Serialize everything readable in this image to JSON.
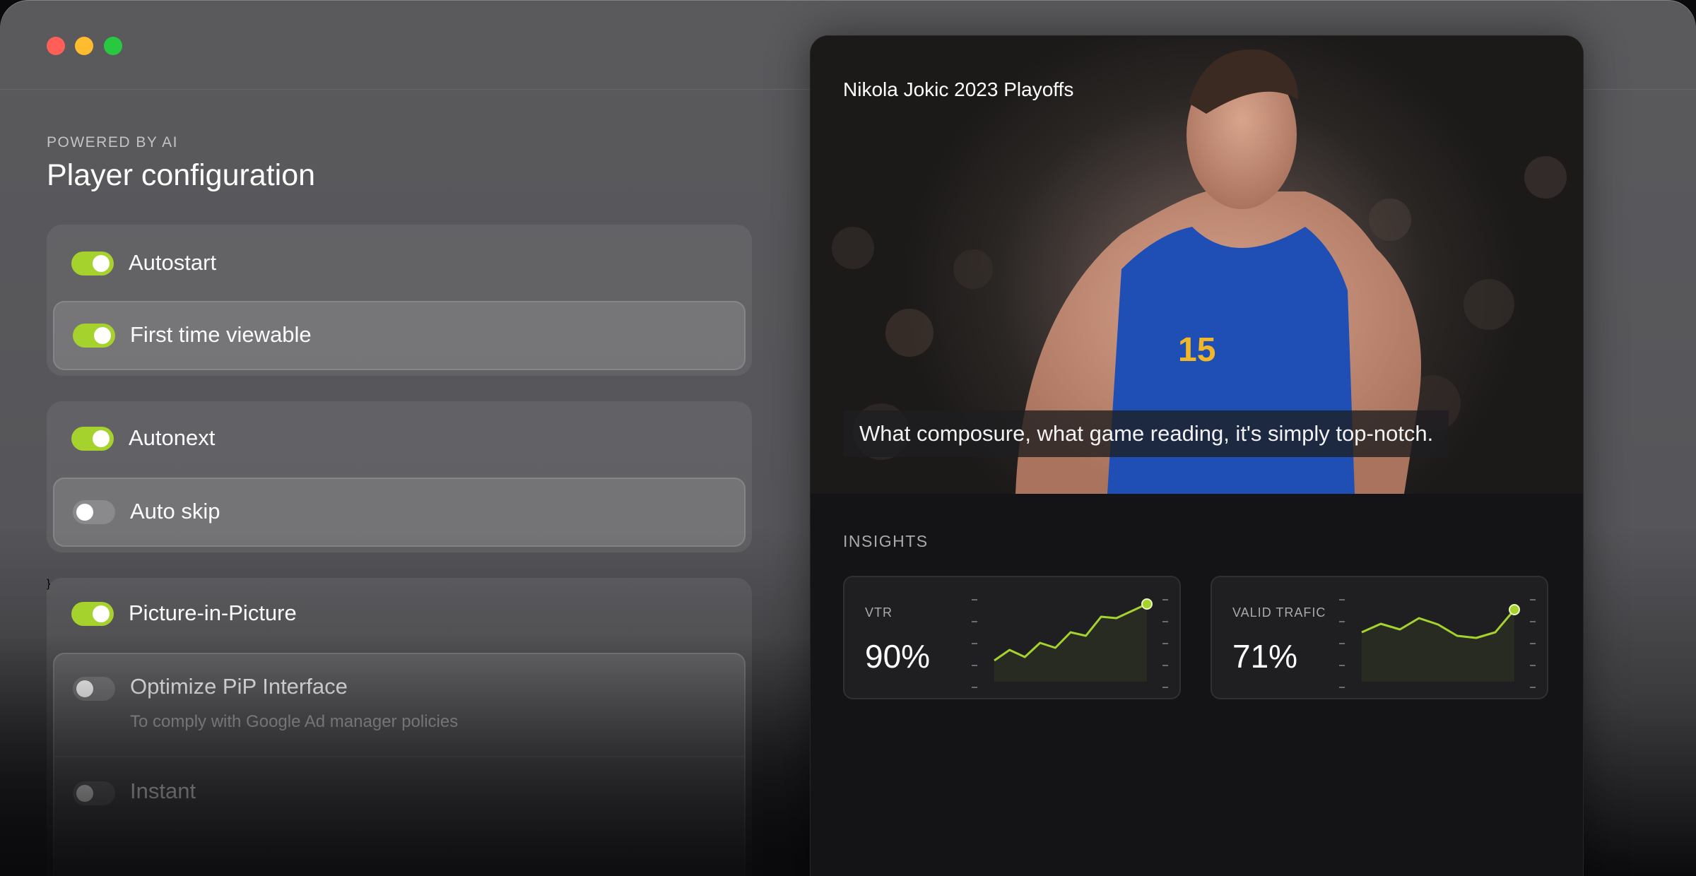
{
  "config": {
    "eyebrow": "POWERED BY AI",
    "title": "Player configuration",
    "groups": [
      {
        "main": {
          "label": "Autostart",
          "on": true
        },
        "sub": {
          "label": "First time viewable",
          "on": true
        }
      },
      {
        "main": {
          "label": "Autonext",
          "on": true
        },
        "sub": {
          "label": "Auto skip",
          "on": false
        }
      },
      {
        "main": {
          "label": "Picture-in-Picture",
          "on": true
        },
        "sub": {
          "label": "Optimize PiP Interface",
          "hint": "To comply with Google Ad manager policies",
          "on": false
        },
        "sub2": {
          "label": "Instant",
          "on": false
        }
      }
    ]
  },
  "video": {
    "title": "Nikola Jokic 2023 Playoffs",
    "caption": "What composure, what game reading, it's simply top-notch."
  },
  "insights": {
    "heading": "INSIGHTS",
    "accent": "#a6d22d",
    "cards": [
      {
        "name": "VTR",
        "value": "90%",
        "trend": [
          0.2,
          0.35,
          0.25,
          0.45,
          0.38,
          0.6,
          0.55,
          0.82,
          0.8,
          0.9,
          1.0
        ]
      },
      {
        "name": "VALID TRAFIC",
        "value": "71%",
        "trend": [
          0.6,
          0.72,
          0.64,
          0.8,
          0.71,
          0.55,
          0.52,
          0.6,
          0.92
        ]
      }
    ]
  }
}
